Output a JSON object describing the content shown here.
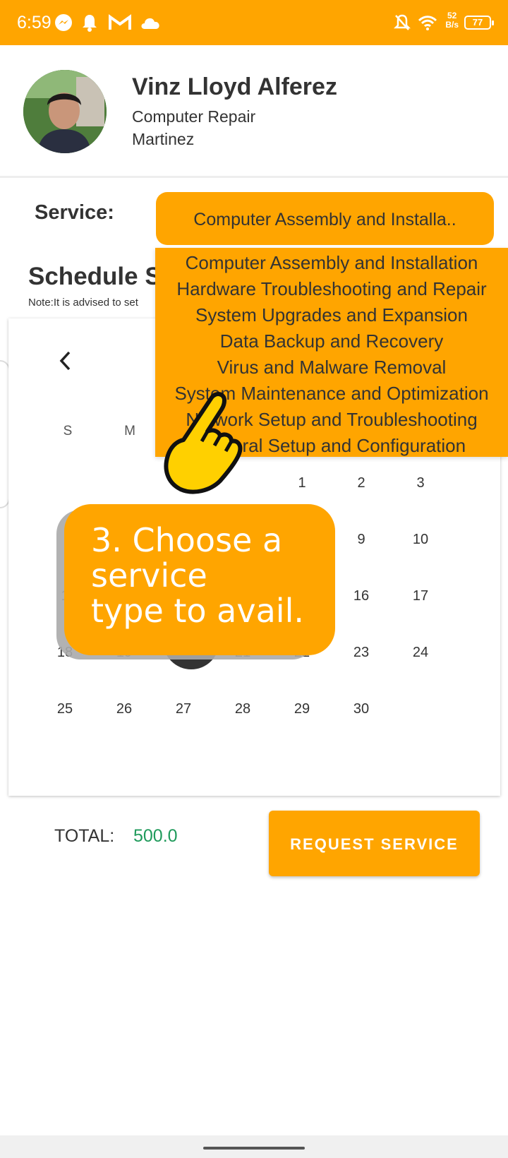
{
  "status_bar": {
    "time": "6:59",
    "net_speed_value": "52",
    "net_speed_unit": "B/s",
    "battery": "77",
    "icons": [
      "messenger-icon",
      "bell-icon",
      "gmail-icon",
      "cloud-icon",
      "mute-bell-icon",
      "wifi-icon",
      "battery-icon"
    ]
  },
  "profile": {
    "name": "Vinz Lloyd Alferez",
    "profession": "Computer Repair",
    "location": "Martinez"
  },
  "service": {
    "label": "Service:",
    "selected": "Computer Assembly and Installa..",
    "options": [
      "Computer Assembly and Installation",
      "Hardware Troubleshooting and Repair",
      "System Upgrades and Expansion",
      "Data Backup and Recovery",
      "Virus and Malware Removal",
      "System Maintenance and Optimization",
      "Network Setup and Troubleshooting",
      "General Setup and Configuration"
    ]
  },
  "schedule": {
    "title": "Schedule S",
    "note": "Note:It is advised to set"
  },
  "calendar": {
    "weekday_headers": [
      "S",
      "M"
    ],
    "selected_day": "20",
    "rows": [
      [
        "",
        "",
        "",
        "",
        "1",
        "2",
        "3"
      ],
      [
        "",
        "",
        "",
        "",
        "",
        "9",
        "10"
      ],
      [
        "1",
        "",
        "",
        "",
        "",
        "16",
        "17"
      ],
      [
        "18",
        "19",
        "",
        "21",
        "22",
        "23",
        "24"
      ],
      [
        "25",
        "26",
        "27",
        "28",
        "29",
        "30",
        ""
      ]
    ]
  },
  "tutorial": {
    "tip_lines": [
      "3. Choose a",
      "service",
      "type to avail."
    ],
    "hand_icon": "pointing-hand-icon"
  },
  "footer": {
    "total_label": "TOTAL:",
    "total_value": "500.0",
    "request_label": "REQUEST SERVICE"
  },
  "colors": {
    "accent": "#FFA500",
    "total_value": "#1f9a5b",
    "selected_day": "#333333"
  }
}
